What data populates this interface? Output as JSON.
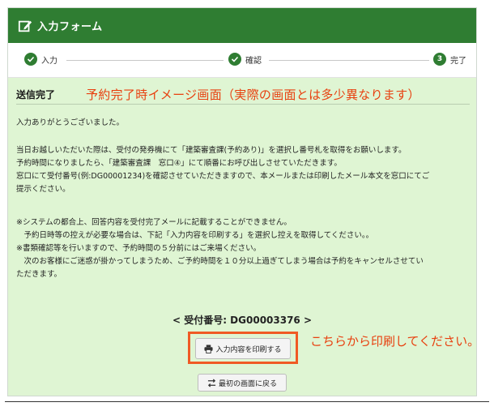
{
  "header": {
    "title": "入力フォーム",
    "icon": "edit-icon",
    "color": "#2f7d32"
  },
  "stepper": {
    "steps": [
      {
        "label": "入力",
        "state": "done"
      },
      {
        "label": "確認",
        "state": "done"
      },
      {
        "number": "3",
        "label": "完了",
        "state": "current"
      }
    ]
  },
  "content": {
    "heading": "送信完了",
    "overlay_note": "予約完了時イメージ画面（実際の画面とは多少異なります）",
    "thanks": "入力ありがとうございました。",
    "instructions": [
      "当日お越しいただいた際は、受付の発券機にて「建築審査課(予約あり)」を選択し番号札を取得をお願いします。",
      "予約時間になりましたら、「建築審査課　窓口④」にて順番にお呼び出しさせていただきます。",
      "窓口にて受付番号(例:DG00001234)を確認させていただきますので、本メールまたは印刷したメール本文を窓口にてご",
      "提示ください。"
    ],
    "notes": [
      "※システムの都合上、回答内容を受付完了メールに記載することができません。",
      "　予約日時等の控えが必要な場合は、下記「入力内容を印刷する」を選択し控えを取得してください。。",
      "※書類確認等を行いますので、予約時間の５分前にはご来場ください。",
      "　次のお客様にご迷惑が掛かってしまうため、ご予約時間を１０分以上過ぎてしまう場合は予約をキャンセルさせてい",
      "ただきます。"
    ],
    "receipt": "< 受付番号: DG00003376 >",
    "print_button": "入力内容を印刷する",
    "back_button": "最初の画面に戻る",
    "print_note": "こちらから印刷してください。",
    "accent_color": "#e8400f",
    "bg_color": "#dff5d3"
  }
}
